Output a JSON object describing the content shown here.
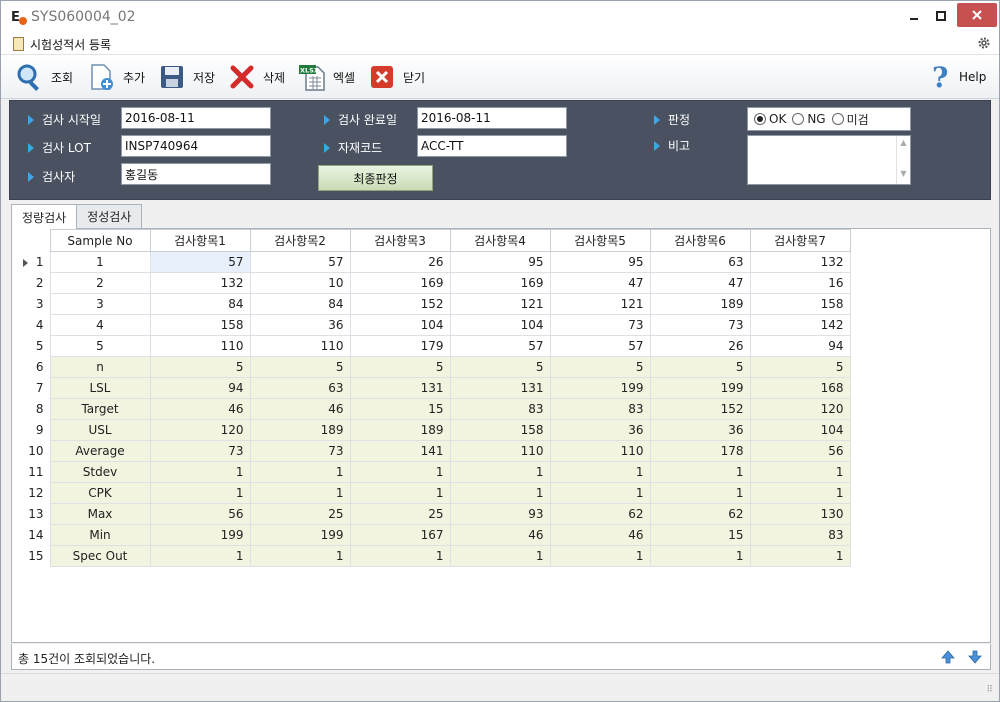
{
  "window": {
    "title": "SYS060004_02"
  },
  "header": {
    "title": "시험성적서 등록"
  },
  "toolbar": {
    "search": "조회",
    "add": "추가",
    "save": "저장",
    "delete": "삭제",
    "excel": "엑셀",
    "close": "닫기",
    "help": "Help",
    "excel_badge": "XLSX"
  },
  "filter": {
    "start_date_label": "검사 시작일",
    "start_date_value": "2016-08-11",
    "end_date_label": "검사 완료일",
    "end_date_value": "2016-08-11",
    "lot_label": "검사 LOT",
    "lot_value": "INSP740964",
    "material_label": "자재코드",
    "material_value": "ACC-TT",
    "inspector_label": "검사자",
    "inspector_value": "홍길동",
    "final_button": "최종판정",
    "judgment_label": "판정",
    "judgment_options": [
      "OK",
      "NG",
      "미검"
    ],
    "judgment_selected": "OK",
    "remark_label": "비고",
    "remark_value": ""
  },
  "tabs": [
    "정량검사",
    "정성검사"
  ],
  "grid": {
    "columns": [
      "Sample No",
      "검사항목1",
      "검사항목2",
      "검사항목3",
      "검사항목4",
      "검사항목5",
      "검사항목6",
      "검사항목7"
    ],
    "rows": [
      {
        "n": "1",
        "sample": "1",
        "v": [
          "57",
          "57",
          "26",
          "95",
          "95",
          "63",
          "132"
        ]
      },
      {
        "n": "2",
        "sample": "2",
        "v": [
          "132",
          "10",
          "169",
          "169",
          "47",
          "47",
          "16"
        ]
      },
      {
        "n": "3",
        "sample": "3",
        "v": [
          "84",
          "84",
          "152",
          "121",
          "121",
          "189",
          "158"
        ]
      },
      {
        "n": "4",
        "sample": "4",
        "v": [
          "158",
          "36",
          "104",
          "104",
          "73",
          "73",
          "142"
        ]
      },
      {
        "n": "5",
        "sample": "5",
        "v": [
          "110",
          "110",
          "179",
          "57",
          "57",
          "26",
          "94"
        ]
      },
      {
        "n": "6",
        "sample": "n",
        "v": [
          "5",
          "5",
          "5",
          "5",
          "5",
          "5",
          "5"
        ]
      },
      {
        "n": "7",
        "sample": "LSL",
        "v": [
          "94",
          "63",
          "131",
          "131",
          "199",
          "199",
          "168"
        ]
      },
      {
        "n": "8",
        "sample": "Target",
        "v": [
          "46",
          "46",
          "15",
          "83",
          "83",
          "152",
          "120"
        ]
      },
      {
        "n": "9",
        "sample": "USL",
        "v": [
          "120",
          "189",
          "189",
          "158",
          "36",
          "36",
          "104"
        ]
      },
      {
        "n": "10",
        "sample": "Average",
        "v": [
          "73",
          "73",
          "141",
          "110",
          "110",
          "178",
          "56"
        ]
      },
      {
        "n": "11",
        "sample": "Stdev",
        "v": [
          "1",
          "1",
          "1",
          "1",
          "1",
          "1",
          "1"
        ]
      },
      {
        "n": "12",
        "sample": "CPK",
        "v": [
          "1",
          "1",
          "1",
          "1",
          "1",
          "1",
          "1"
        ]
      },
      {
        "n": "13",
        "sample": "Max",
        "v": [
          "56",
          "25",
          "25",
          "93",
          "62",
          "62",
          "130"
        ]
      },
      {
        "n": "14",
        "sample": "Min",
        "v": [
          "199",
          "199",
          "167",
          "46",
          "46",
          "15",
          "83"
        ]
      },
      {
        "n": "15",
        "sample": "Spec Out",
        "v": [
          "1",
          "1",
          "1",
          "1",
          "1",
          "1",
          "1"
        ]
      }
    ]
  },
  "status": {
    "message": "총 15건이 조회되었습니다."
  }
}
